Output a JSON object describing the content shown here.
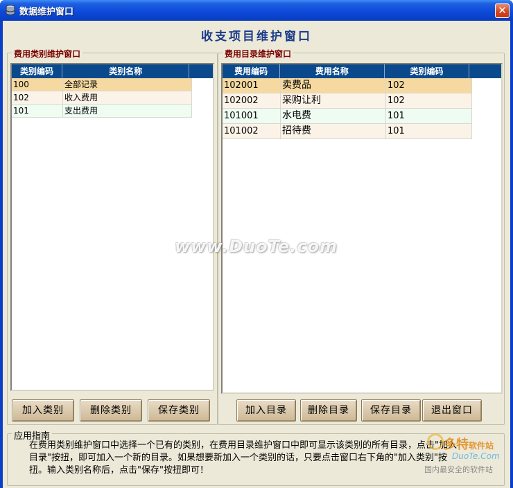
{
  "window": {
    "title": "数据维护窗口",
    "close_glyph": "✕"
  },
  "main_title": "收支项目维护窗口",
  "category_panel": {
    "label": "费用类别维护窗口",
    "columns": [
      "类别编码",
      "类别名称"
    ],
    "rows": [
      {
        "code": "100",
        "name": "全部记录"
      },
      {
        "code": "102",
        "name": "收入费用"
      },
      {
        "code": "101",
        "name": "支出费用"
      }
    ],
    "buttons": {
      "add": "加入类别",
      "delete": "删除类别",
      "save": "保存类别"
    }
  },
  "item_panel": {
    "label": "费用目录维护窗口",
    "columns": [
      "费用编码",
      "费用名称",
      "类别编码"
    ],
    "rows": [
      {
        "code": "102001",
        "name": "卖费品",
        "cat": "102"
      },
      {
        "code": "102002",
        "name": "采购让利",
        "cat": "102"
      },
      {
        "code": "101001",
        "name": "水电费",
        "cat": "101"
      },
      {
        "code": "101002",
        "name": "招待费",
        "cat": "101"
      }
    ],
    "buttons": {
      "add": "加入目录",
      "delete": "删除目录",
      "save": "保存目录",
      "exit": "退出窗口"
    }
  },
  "guide": {
    "label": "应用指南",
    "text": "在费用类别维护窗口中选择一个已有的类别，在费用目录维护窗口中即可显示该类别的所有目录，点击\"加入目录\"按扭，即可加入一个新的目录。如果想要新加入一个类别的话，只要点击窗口右下角的\"加入类别\"按扭。输入类别名称后，点击\"保存\"按扭即可！"
  },
  "watermark": "www.DuoTe.com",
  "corner_logo": {
    "brand": "多特",
    "suffix": "软件站",
    "site": "DuoTe.Com",
    "slogan": "国内最安全的软件站"
  },
  "colors": {
    "title_bar": "#0b48d8",
    "grid_header": "#0a4a8c",
    "selected_row": "#f5d9a0",
    "group_label": "#7a0000"
  }
}
